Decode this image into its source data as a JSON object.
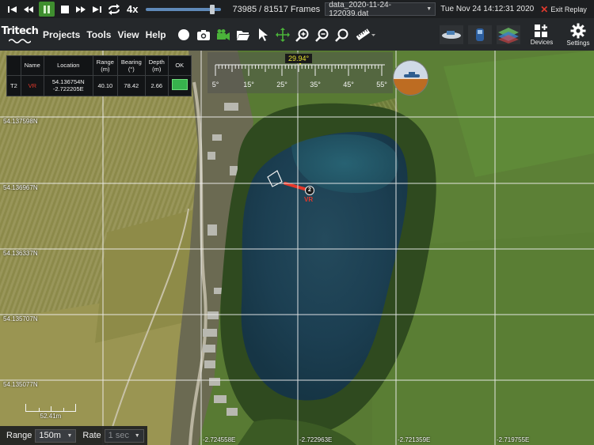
{
  "playback": {
    "speed": "4x",
    "progress": 0.907,
    "frame_current": "73985",
    "frame_total": "81517",
    "frames_label": "Frames",
    "file": "data_2020-11-24-122039.dat",
    "timestamp": "Tue Nov 24 14:12:31 2020",
    "exit_label": "Exit Replay"
  },
  "menubar": {
    "logo": "Tritech",
    "menus": [
      "Projects",
      "Tools",
      "View",
      "Help"
    ],
    "devices_label": "Devices",
    "settings_label": "Settings"
  },
  "targets": {
    "headers": [
      "Name",
      "Location",
      "Range\n(m)",
      "Bearing\n(°)",
      "Depth\n(m)",
      "OK"
    ],
    "rows": [
      {
        "id": "T2",
        "name": "VR",
        "lat": "54.136754N",
        "lon": "-2.722205E",
        "range": "40.10",
        "bearing": "78.42",
        "depth": "2.66",
        "ok_color": "#37b24d"
      }
    ]
  },
  "bearing_scale": {
    "value": "29.94°",
    "labels": [
      "5°",
      "15°",
      "25°",
      "35°",
      "45°",
      "55°"
    ]
  },
  "map": {
    "lat_labels": [
      "54.137598N",
      "54.136967N",
      "54.136337N",
      "54.135707N",
      "54.135077N"
    ],
    "lon_labels": [
      "-2.724558E",
      "-2.722963E",
      "-2.721359E",
      "-2.719755E"
    ],
    "target_number": "2",
    "target_tag": "VR",
    "scale_label": "52.41m"
  },
  "bottom": {
    "range_label": "Range",
    "range_value": "150m",
    "rate_label": "Rate",
    "rate_value": "1 sec"
  },
  "colors": {
    "accent_green": "#3f8f2f",
    "target_red": "#e4382b",
    "bearing_value": "#e8e430"
  }
}
